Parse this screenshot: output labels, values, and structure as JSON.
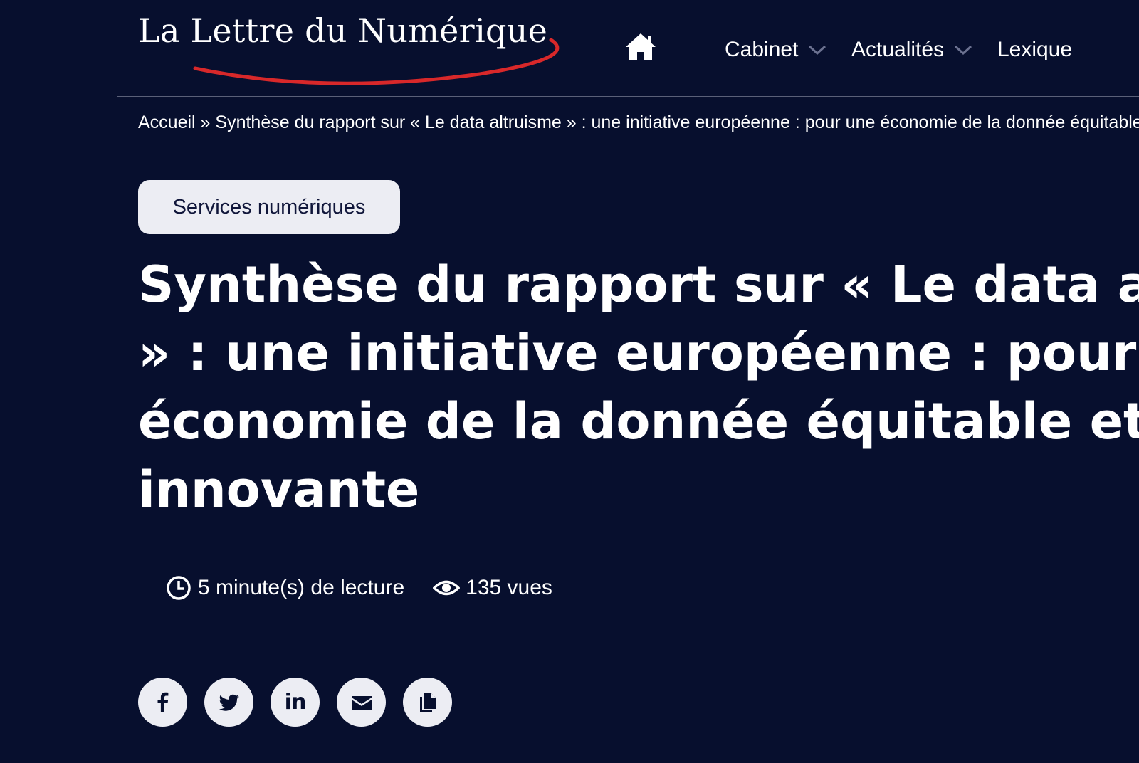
{
  "header": {
    "logo_text": "La Lettre du Numérique",
    "home_icon": "home-icon",
    "nav": [
      {
        "label": "Cabinet",
        "has_dropdown": true
      },
      {
        "label": "Actualités",
        "has_dropdown": true
      },
      {
        "label": "Lexique",
        "has_dropdown": false
      }
    ]
  },
  "breadcrumb": {
    "home": "Accueil",
    "separator": "»",
    "current": "Synthèse du rapport sur « Le data altruisme » : une initiative européenne : pour une économie de la donnée équitable et innovante"
  },
  "article": {
    "category": "Services numériques",
    "title_lines": [
      "Synthèse du rapport sur « Le data altruisme",
      "» : une initiative européenne : pour une",
      "économie de la donnée équitable et",
      "innovante"
    ],
    "reading_time": "5 minute(s) de lecture",
    "views": "135 vues"
  },
  "share": [
    {
      "icon": "facebook-icon"
    },
    {
      "icon": "twitter-icon"
    },
    {
      "icon": "linkedin-icon",
      "text": "in"
    },
    {
      "icon": "email-icon"
    },
    {
      "icon": "copy-link-icon"
    }
  ],
  "colors": {
    "background": "#070f2e",
    "text": "#ffffff",
    "accent_red": "#d8282a",
    "badge_bg": "#ecedf3",
    "badge_text": "#10163a"
  }
}
